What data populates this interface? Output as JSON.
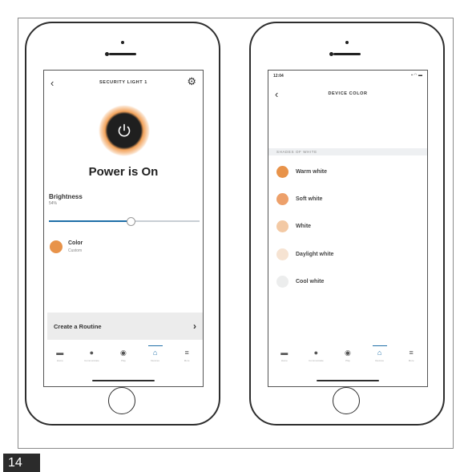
{
  "page_number": "14",
  "left_phone": {
    "header": {
      "back_icon": "chevron-left-icon",
      "title": "SECURITY LIGHT 1",
      "settings_icon": "gear-icon"
    },
    "power": {
      "icon": "power-icon",
      "status": "Power is On",
      "glow_color": "#f2a25a"
    },
    "brightness": {
      "label": "Brightness",
      "value": "54%",
      "level": 0.54
    },
    "color": {
      "label": "Color",
      "value": "Custom",
      "swatch": "#e8934a"
    },
    "routine": {
      "label": "Create a Routine",
      "chevron": "›"
    },
    "tabs": [
      {
        "label": "Home",
        "icon": "home-icon",
        "active": false
      },
      {
        "label": "Communicate",
        "icon": "chat-icon",
        "active": false
      },
      {
        "label": "Play",
        "icon": "play-icon",
        "active": false
      },
      {
        "label": "Devices",
        "icon": "devices-icon",
        "active": true
      },
      {
        "label": "More",
        "icon": "menu-icon",
        "active": false
      }
    ]
  },
  "right_phone": {
    "status_bar": {
      "time": "12:04",
      "icons": "signal-wifi-battery"
    },
    "header": {
      "back_icon": "chevron-left-icon",
      "title": "DEVICE COLOR"
    },
    "section_header": "SHADES OF WHITE",
    "shades": [
      {
        "label": "Warm white",
        "color": "#e8934a"
      },
      {
        "label": "Soft white",
        "color": "#eda06a"
      },
      {
        "label": "White",
        "color": "#f3c9a4"
      },
      {
        "label": "Daylight white",
        "color": "#f6e3d2"
      },
      {
        "label": "Cool white",
        "color": "#eceded"
      }
    ],
    "tabs": [
      {
        "label": "Home",
        "icon": "home-icon",
        "active": false
      },
      {
        "label": "Communicate",
        "icon": "chat-icon",
        "active": false
      },
      {
        "label": "Play",
        "icon": "play-icon",
        "active": false
      },
      {
        "label": "Devices",
        "icon": "devices-icon",
        "active": true
      },
      {
        "label": "More",
        "icon": "menu-icon",
        "active": false
      }
    ]
  }
}
